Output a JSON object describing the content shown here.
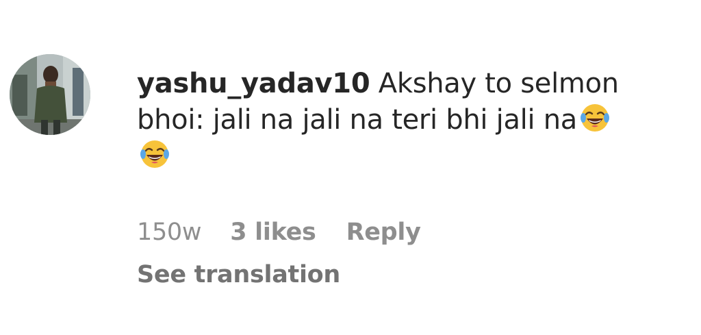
{
  "comment": {
    "username": "yashu_yadav10",
    "text_line1": " Akshay to selmon",
    "text_line2": "bhoi: jali na jali na teri bhi jali na",
    "emoji_1": "face-with-tears-of-joy-icon",
    "emoji_2": "face-with-tears-of-joy-icon",
    "time": "150w",
    "likes": "3 likes",
    "reply_label": "Reply",
    "translation_label": "See translation"
  },
  "colors": {
    "text": "#262626",
    "secondary": "#8e8e8e",
    "emoji_face": "#f7c33a"
  }
}
